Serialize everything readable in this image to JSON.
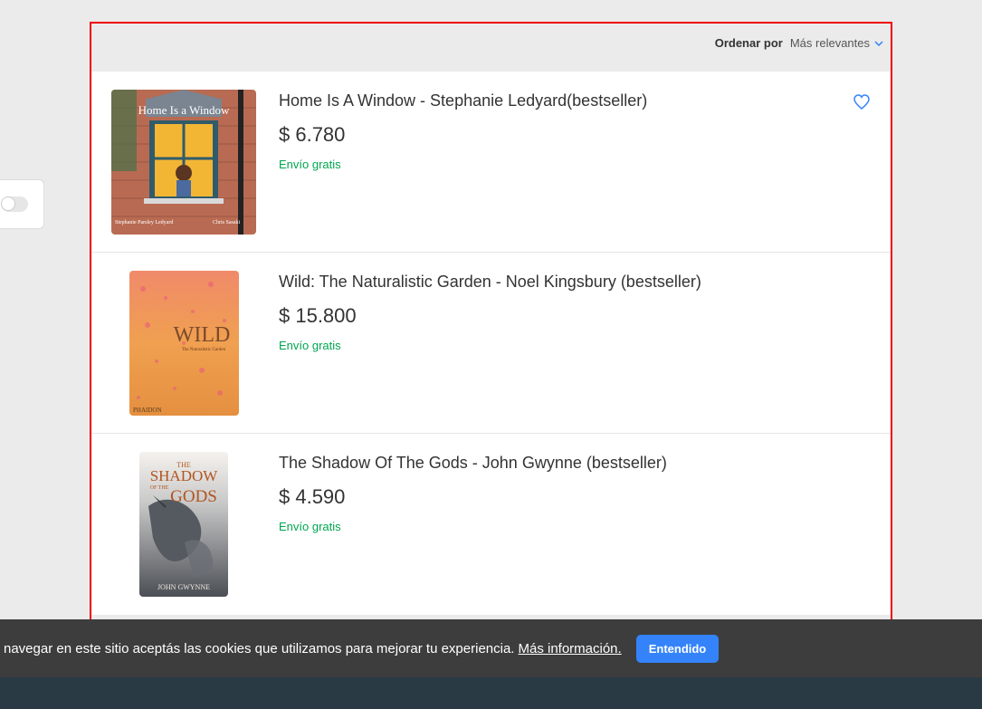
{
  "sort": {
    "label": "Ordenar por",
    "value": "Más relevantes"
  },
  "items": [
    {
      "title": "Home Is A Window - Stephanie Ledyard(bestseller)",
      "price": "$ 6.780",
      "shipping": "Envío gratis",
      "cover_title": "Home Is a Window",
      "cover_author": "Stephanie Parsley Ledyard",
      "cover_illustrator": "Chris Sasaki"
    },
    {
      "title": "Wild: The Naturalistic Garden - Noel Kingsbury (bestseller)",
      "price": "$ 15.800",
      "shipping": "Envío gratis",
      "cover_title": "WILD",
      "cover_subtitle": "The Naturalistic Garden",
      "cover_publisher": "PHAIDON"
    },
    {
      "title": "The Shadow Of The Gods - John Gwynne (bestseller)",
      "price": "$ 4.590",
      "shipping": "Envío gratis",
      "cover_title_1": "THE",
      "cover_title_2": "SHADOW",
      "cover_title_3": "OF THE",
      "cover_title_4": "GODS",
      "cover_author": "JOHN GWYNNE"
    }
  ],
  "cookie": {
    "text": "navegar en este sitio aceptás las cookies que utilizamos para mejorar tu experiencia.",
    "link": "Más información.",
    "button": "Entendido"
  },
  "colors": {
    "accent": "#3483fa",
    "shipping": "#00a650",
    "frame": "#e00000"
  },
  "icons": {
    "favorite": "heart-icon",
    "sort": "chevron-down-icon"
  }
}
